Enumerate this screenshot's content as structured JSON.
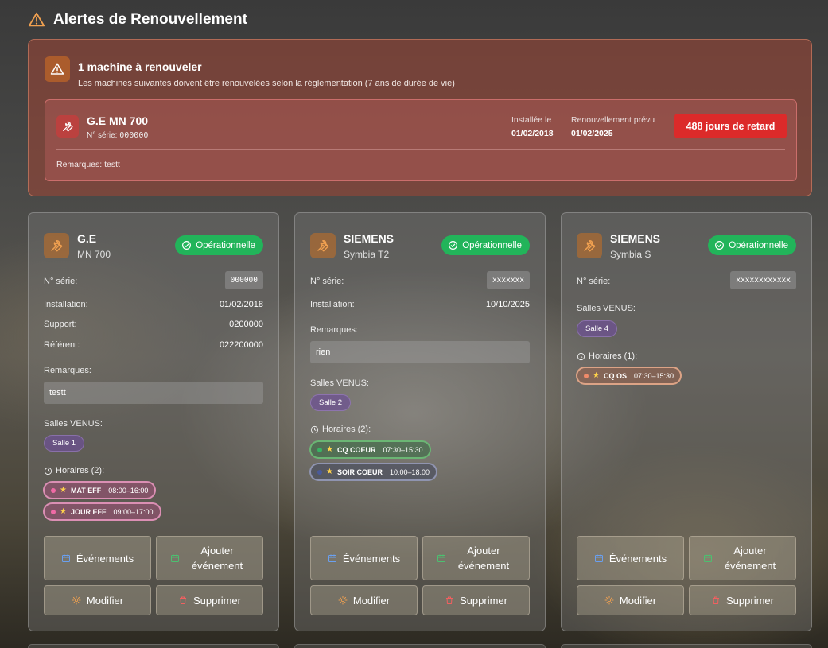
{
  "page_title": "Alertes de Renouvellement",
  "alert": {
    "title": "1 machine à renouveler",
    "description": "Les machines suivantes doivent être renouvelées selon la réglementation (7 ans de durée de vie)",
    "item": {
      "name": "G.E MN 700",
      "serial_label": "N° série:",
      "serial": "000000",
      "installed_label": "Installée le",
      "installed": "01/02/2018",
      "renewal_label": "Renouvellement prévu",
      "renewal": "01/02/2025",
      "late_badge": "488 jours de retard",
      "remarks": "Remarques: testt"
    }
  },
  "labels": {
    "serial": "N° série:",
    "installation": "Installation:",
    "support": "Support:",
    "referent": "Référent:",
    "remarks": "Remarques:",
    "salles": "Salles VENUS:",
    "events_button": "Événements",
    "add_event_button": "Ajouter événement",
    "edit_button": "Modifier",
    "delete_button": "Supprimer"
  },
  "cards": [
    {
      "brand": "G.E",
      "model": "MN 700",
      "status": "Opérationnelle",
      "serial": "000000",
      "installation": "01/02/2018",
      "support": "0200000",
      "referent": "022200000",
      "remarks": "testt",
      "salle": "Salle 1",
      "horaires_title": "Horaires (2):",
      "shifts": [
        {
          "code": "MAT EFF",
          "time": "08:00–16:00"
        },
        {
          "code": "JOUR EFF",
          "time": "09:00–17:00"
        }
      ]
    },
    {
      "brand": "SIEMENS",
      "model": "Symbia T2",
      "status": "Opérationnelle",
      "serial": "xxxxxxx",
      "installation": "10/10/2025",
      "remarks": "rien",
      "salle": "Salle 2",
      "horaires_title": "Horaires (2):",
      "shifts": [
        {
          "code": "CQ COEUR",
          "time": "07:30–15:30"
        },
        {
          "code": "SOIR COEUR",
          "time": "10:00–18:00"
        }
      ]
    },
    {
      "brand": "SIEMENS",
      "model": "Symbia S",
      "status": "Opérationnelle",
      "serial": "xxxxxxxxxxxx",
      "salle": "Salle 4",
      "horaires_title": "Horaires (1):",
      "shifts": [
        {
          "code": "CQ OS",
          "time": "07:30–15:30"
        }
      ]
    }
  ],
  "colors": {
    "status_green": "#22b45a",
    "late_red": "#dc2a2a",
    "accent_orange": "#f0a050"
  }
}
